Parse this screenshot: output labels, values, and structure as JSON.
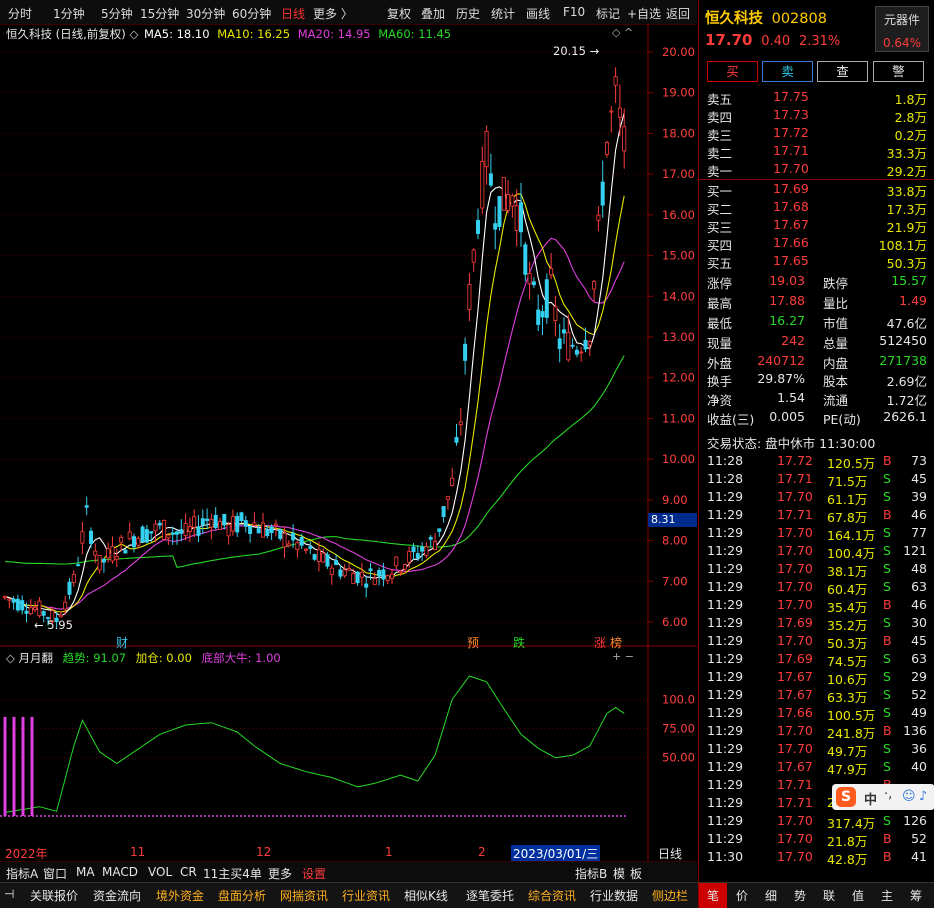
{
  "toolbar": {
    "left_items": [
      "分时",
      "1分钟",
      "5分钟",
      "15分钟",
      "30分钟",
      "60分钟",
      "日线",
      "更多 〉"
    ],
    "active": "日线",
    "right_items": [
      "复权",
      "叠加",
      "历史",
      "统计",
      "画线",
      "F10",
      "标记",
      "+自选",
      "返回"
    ]
  },
  "chart": {
    "title": "恒久科技 (日线,前复权)",
    "ma_legend": [
      {
        "label": "MA5: 18.10",
        "color": "#ffffff"
      },
      {
        "label": "MA10: 16.25",
        "color": "#e8e800"
      },
      {
        "label": "MA20: 14.95",
        "color": "#e040e0"
      },
      {
        "label": "MA60: 11.45",
        "color": "#27d827"
      }
    ],
    "price_ticks": [
      "20.00",
      "19.00",
      "18.00",
      "17.00",
      "16.00",
      "15.00",
      "14.00",
      "13.00",
      "12.00",
      "11.00",
      "10.00",
      "9.00",
      "8.00",
      "7.00",
      "6.00"
    ],
    "high_label": "20.15",
    "low_label": "← 5.95",
    "current_price_box": "8.31",
    "markers": [
      {
        "text": "财",
        "color": "#35c7e8"
      },
      {
        "text": "预",
        "color": "#ff8a30"
      },
      {
        "text": "跌",
        "color": "#27d827"
      },
      {
        "text": "涨",
        "color": "#ff3c3c"
      },
      {
        "text": "榜",
        "color": "#ff8a30"
      }
    ]
  },
  "indicator": {
    "name": "月月翻",
    "trend_label": "趋势: 91.07",
    "add_label": "加仓: 0.00",
    "bottom_label": "底部大牛: 1.00",
    "ticks": [
      "100.0",
      "75.00",
      "50.00"
    ]
  },
  "date_axis": {
    "labels": [
      "2022年",
      "11",
      "12",
      "1",
      "2"
    ],
    "highlight": "2023/03/01/三",
    "period": "日线"
  },
  "chart_data": {
    "type": "candlestick",
    "title": "恒久科技 (日线,前复权)",
    "ylim": [
      5.5,
      20.5
    ],
    "ma_values": {
      "MA5": 18.1,
      "MA10": 16.25,
      "MA20": 14.95,
      "MA60": 11.45
    },
    "high": 20.15,
    "low": 5.95,
    "indicator": {
      "name": "月月翻",
      "趋势": 91.07,
      "加仓": 0.0,
      "底部大牛": 1.0,
      "ylim": [
        0,
        120
      ]
    }
  },
  "bottom_tabs": [
    "指标A",
    "窗口",
    "MA",
    "MACD",
    "VOL",
    "CR",
    "11主买4单",
    "更多",
    "设置"
  ],
  "bottom_tabs_right": [
    "指标B",
    "模",
    "板"
  ],
  "nav_tabs": [
    "关联报价",
    "资金流向",
    "境外资金",
    "盘面分析",
    "网揣资讯",
    "行业资讯",
    "相似K线",
    "逐笔委托",
    "综合资讯",
    "行业数据",
    "侧边栏"
  ],
  "right_panel": {
    "stock_name": "恒久科技",
    "stock_code": "002808",
    "component_btn": "元器件",
    "price": "17.70",
    "change": "0.40",
    "change_pct": "2.31%",
    "component_pct": "0.64%",
    "trade_buttons": [
      "买",
      "卖",
      "查",
      "警"
    ],
    "sell_levels": [
      {
        "label": "卖五",
        "price": "17.75",
        "vol": "1.8万"
      },
      {
        "label": "卖四",
        "price": "17.73",
        "vol": "2.8万"
      },
      {
        "label": "卖三",
        "price": "17.72",
        "vol": "0.2万"
      },
      {
        "label": "卖二",
        "price": "17.71",
        "vol": "33.3万"
      },
      {
        "label": "卖一",
        "price": "17.70",
        "vol": "29.2万"
      }
    ],
    "buy_levels": [
      {
        "label": "买一",
        "price": "17.69",
        "vol": "33.8万"
      },
      {
        "label": "买二",
        "price": "17.68",
        "vol": "17.3万"
      },
      {
        "label": "买三",
        "price": "17.67",
        "vol": "21.9万"
      },
      {
        "label": "买四",
        "price": "17.66",
        "vol": "108.1万"
      },
      {
        "label": "买五",
        "price": "17.65",
        "vol": "50.3万"
      }
    ],
    "stats": [
      {
        "l1": "涨停",
        "v1": "19.03",
        "c1": "red",
        "l2": "跌停",
        "v2": "15.57",
        "c2": "green"
      },
      {
        "l1": "最高",
        "v1": "17.88",
        "c1": "red",
        "l2": "量比",
        "v2": "1.49",
        "c2": "red"
      },
      {
        "l1": "最低",
        "v1": "16.27",
        "c1": "green",
        "l2": "市值",
        "v2": "47.6亿",
        "c2": "white"
      },
      {
        "l1": "现量",
        "v1": "242",
        "c1": "red",
        "l2": "总量",
        "v2": "512450",
        "c2": "white"
      },
      {
        "l1": "外盘",
        "v1": "240712",
        "c1": "red",
        "l2": "内盘",
        "v2": "271738",
        "c2": "green"
      }
    ],
    "stats2": [
      {
        "l1": "换手",
        "v1": "29.87%",
        "l2": "股本",
        "v2": "2.69亿"
      },
      {
        "l1": "净资",
        "v1": "1.54",
        "l2": "流通",
        "v2": "1.72亿"
      },
      {
        "l1": "收益(三)",
        "v1": "0.005",
        "l2": "PE(动)",
        "v2": "2626.1"
      }
    ],
    "trade_status": "交易状态: 盘中休市 11:30:00",
    "ticks": [
      {
        "t": "11:28",
        "p": "17.72",
        "v": "120.5万",
        "s": "B",
        "n": "73"
      },
      {
        "t": "11:28",
        "p": "17.71",
        "v": "71.5万",
        "s": "S",
        "n": "45"
      },
      {
        "t": "11:29",
        "p": "17.70",
        "v": "61.1万",
        "s": "S",
        "n": "39"
      },
      {
        "t": "11:29",
        "p": "17.71",
        "v": "67.8万",
        "s": "B",
        "n": "46"
      },
      {
        "t": "11:29",
        "p": "17.70",
        "v": "164.1万",
        "s": "S",
        "n": "77"
      },
      {
        "t": "11:29",
        "p": "17.70",
        "v": "100.4万",
        "s": "S",
        "n": "121"
      },
      {
        "t": "11:29",
        "p": "17.70",
        "v": "38.1万",
        "s": "S",
        "n": "48"
      },
      {
        "t": "11:29",
        "p": "17.70",
        "v": "60.4万",
        "s": "S",
        "n": "63"
      },
      {
        "t": "11:29",
        "p": "17.70",
        "v": "35.4万",
        "s": "B",
        "n": "46"
      },
      {
        "t": "11:29",
        "p": "17.69",
        "v": "35.2万",
        "s": "S",
        "n": "30"
      },
      {
        "t": "11:29",
        "p": "17.70",
        "v": "50.3万",
        "s": "B",
        "n": "45"
      },
      {
        "t": "11:29",
        "p": "17.69",
        "v": "74.5万",
        "s": "S",
        "n": "63"
      },
      {
        "t": "11:29",
        "p": "17.67",
        "v": "10.6万",
        "s": "S",
        "n": "29"
      },
      {
        "t": "11:29",
        "p": "17.67",
        "v": "63.3万",
        "s": "S",
        "n": "52"
      },
      {
        "t": "11:29",
        "p": "17.66",
        "v": "100.5万",
        "s": "S",
        "n": "49"
      },
      {
        "t": "11:29",
        "p": "17.70",
        "v": "241.8万",
        "s": "B",
        "n": "136"
      },
      {
        "t": "11:29",
        "p": "17.70",
        "v": "49.7万",
        "s": "S",
        "n": "36"
      },
      {
        "t": "11:29",
        "p": "17.67",
        "v": "47.9万",
        "s": "S",
        "n": "40"
      },
      {
        "t": "11:29",
        "p": "17.71",
        "v": "",
        "s": "B",
        "n": ""
      },
      {
        "t": "11:29",
        "p": "17.71",
        "v": "2",
        "s": "",
        "n": ""
      },
      {
        "t": "11:29",
        "p": "17.70",
        "v": "317.4万",
        "s": "S",
        "n": "126"
      },
      {
        "t": "11:29",
        "p": "17.70",
        "v": "21.8万",
        "s": "B",
        "n": "52"
      },
      {
        "t": "11:30",
        "p": "17.70",
        "v": "42.8万",
        "s": "B",
        "n": "41"
      }
    ],
    "bottom_tabs": [
      "笔",
      "价",
      "细",
      "势",
      "联",
      "值",
      "主",
      "筹"
    ]
  }
}
